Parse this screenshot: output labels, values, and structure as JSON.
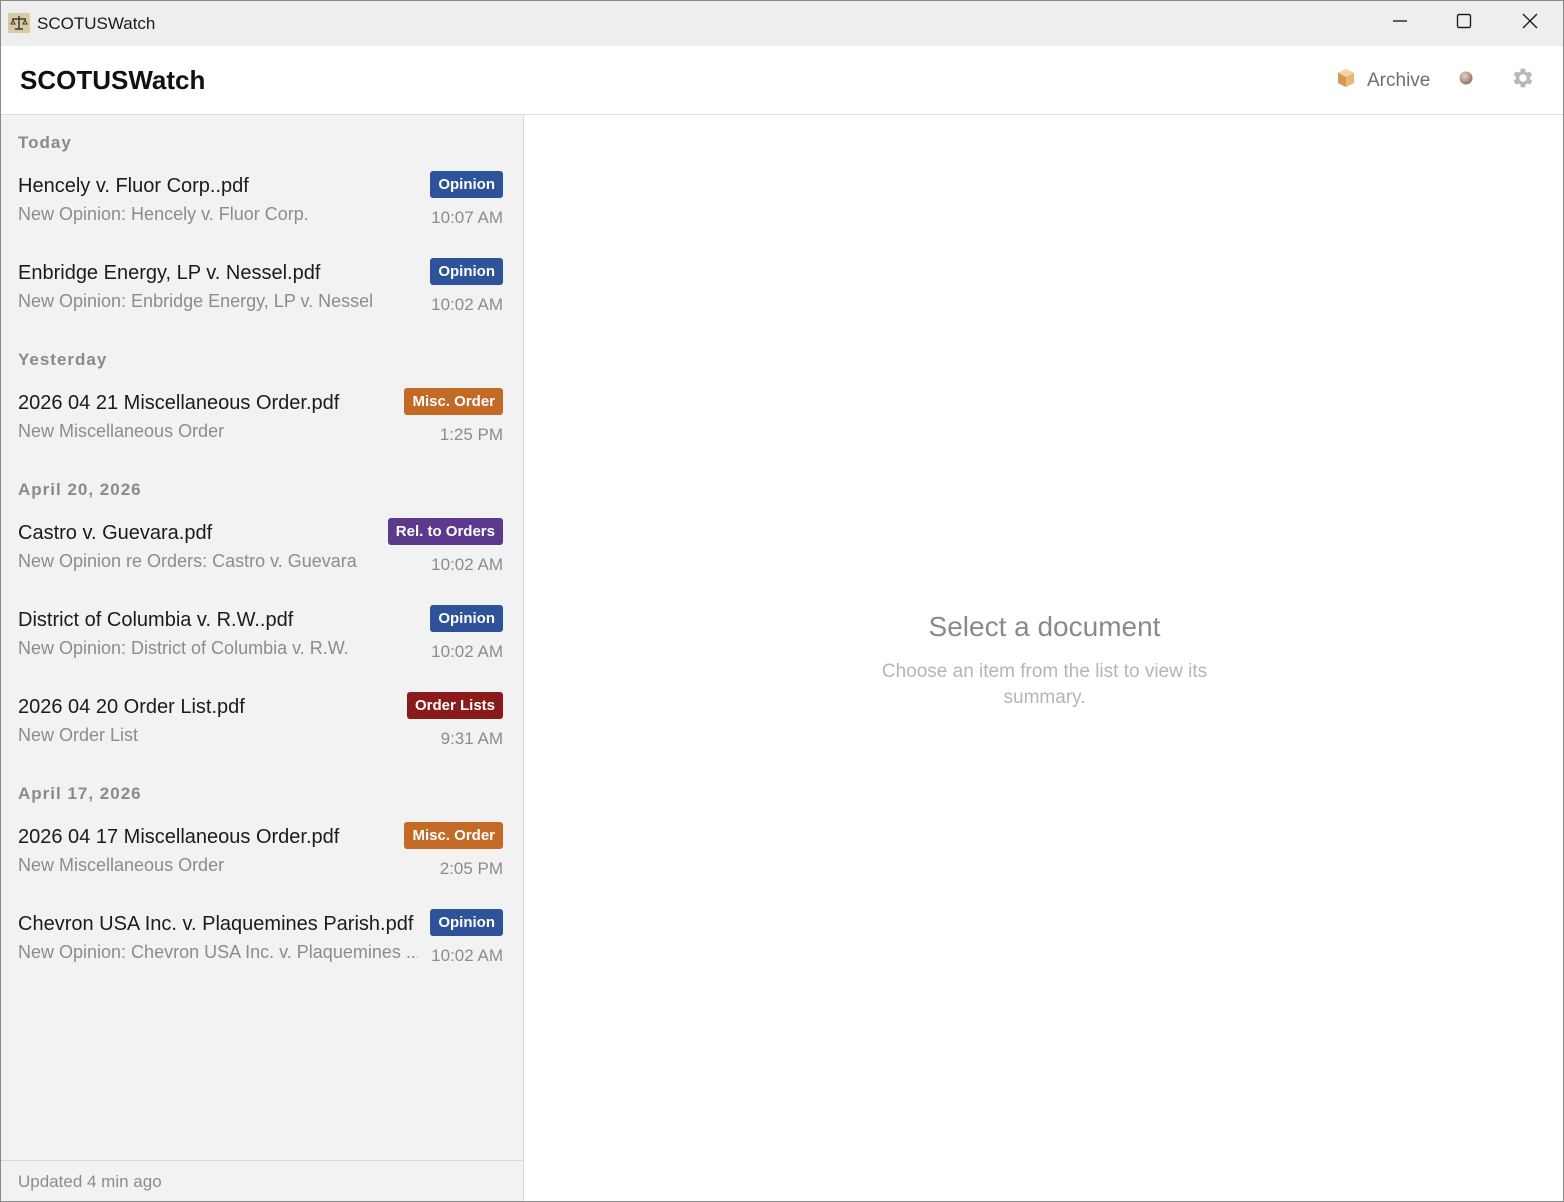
{
  "window": {
    "title": "SCOTUSWatch"
  },
  "header": {
    "title": "SCOTUSWatch",
    "archive_label": "Archive"
  },
  "colors": {
    "opinion": "#2f539b",
    "misc_order": "#c26a26",
    "rel_to_orders": "#5b3a8e",
    "order_lists": "#8b1a1a"
  },
  "sidebar": {
    "sections": [
      {
        "label": "Today",
        "items": [
          {
            "title": "Hencely v. Fluor Corp..pdf",
            "subtitle": "New Opinion: Hencely v. Fluor Corp.",
            "badge": "Opinion",
            "badge_color": "#2f539b",
            "time": "10:07 AM"
          },
          {
            "title": "Enbridge Energy, LP v. Nessel.pdf",
            "subtitle": "New Opinion: Enbridge Energy, LP v. Nessel",
            "badge": "Opinion",
            "badge_color": "#2f539b",
            "time": "10:02 AM"
          }
        ]
      },
      {
        "label": "Yesterday",
        "items": [
          {
            "title": "2026 04 21 Miscellaneous Order.pdf",
            "subtitle": "New Miscellaneous Order",
            "badge": "Misc. Order",
            "badge_color": "#c26a26",
            "time": "1:25 PM"
          }
        ]
      },
      {
        "label": "April 20, 2026",
        "items": [
          {
            "title": "Castro v. Guevara.pdf",
            "subtitle": "New Opinion re Orders: Castro v. Guevara",
            "badge": "Rel. to Orders",
            "badge_color": "#5b3a8e",
            "time": "10:02 AM"
          },
          {
            "title": "District of Columbia v. R.W..pdf",
            "subtitle": "New Opinion: District of Columbia v. R.W.",
            "badge": "Opinion",
            "badge_color": "#2f539b",
            "time": "10:02 AM"
          },
          {
            "title": "2026 04 20 Order List.pdf",
            "subtitle": "New Order List",
            "badge": "Order Lists",
            "badge_color": "#8b1a1a",
            "time": "9:31 AM"
          }
        ]
      },
      {
        "label": "April 17, 2026",
        "items": [
          {
            "title": "2026 04 17 Miscellaneous Order.pdf",
            "subtitle": "New Miscellaneous Order",
            "badge": "Misc. Order",
            "badge_color": "#c26a26",
            "time": "2:05 PM"
          },
          {
            "title": "Chevron USA Inc. v. Plaquemines Parish.pdf",
            "subtitle": "New Opinion: Chevron USA Inc. v. Plaquemines ...",
            "badge": "Opinion",
            "badge_color": "#2f539b",
            "time": "10:02 AM"
          }
        ]
      }
    ],
    "footer": "Updated 4 min ago"
  },
  "main": {
    "empty_title": "Select a document",
    "empty_description": "Choose an item from the list to view its summary."
  }
}
